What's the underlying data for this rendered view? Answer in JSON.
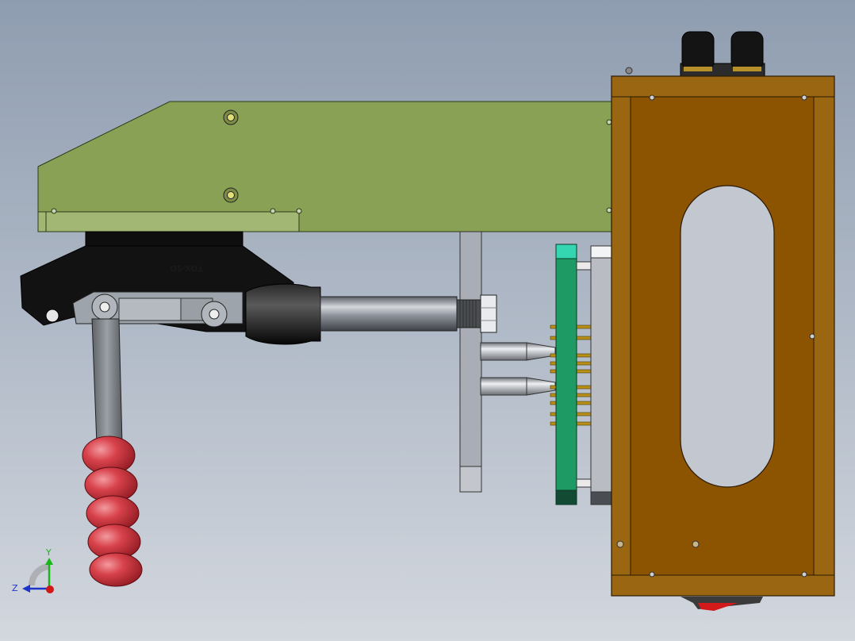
{
  "model": {
    "handle_marking": "TOX-SD",
    "parts": {
      "body_plate": "green-plate",
      "enclosure": "wood-enclosure",
      "clamp": "toggle-clamp",
      "grip": "red-grip"
    }
  },
  "triad": {
    "y_label": "Y",
    "z_label": "Z",
    "colors": {
      "x": "#d01818",
      "y": "#19b619",
      "z": "#1c34c8"
    }
  },
  "colors": {
    "plate": "#88a155",
    "enclosure_frame": "#9a6612",
    "enclosure_panel": "#8c5400",
    "pcb": "#1e9a64",
    "grip": "#c8383f",
    "background_top": "#8f9db0",
    "background_bottom": "#d3d7de"
  }
}
